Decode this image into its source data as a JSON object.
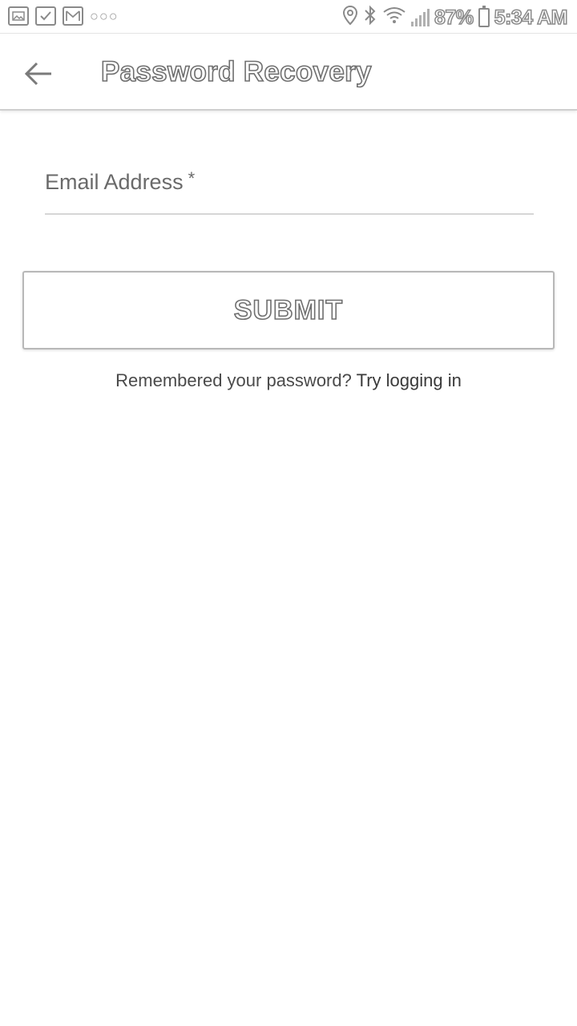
{
  "status_bar": {
    "battery": "87%",
    "time": "5:34 AM",
    "left_icons": [
      "gallery-notification-icon",
      "checkmark-notification-icon",
      "gmail-notification-icon",
      "more-notifications-icon"
    ],
    "right_icons": [
      "location-icon",
      "bluetooth-icon",
      "wifi-icon",
      "signal-icon",
      "battery-icon"
    ]
  },
  "app_bar": {
    "title": "Password Recovery",
    "back_icon": "back-arrow-icon"
  },
  "form": {
    "email_label": "Email Address",
    "email_required_mark": "*",
    "email_value": "",
    "submit_label": "SUBMIT"
  },
  "footer": {
    "prompt": "Remembered your password?",
    "link": "Try logging in"
  },
  "colors": {
    "background": "#ffffff",
    "text": "#4a4a4a",
    "divider": "#d6d6d6"
  }
}
